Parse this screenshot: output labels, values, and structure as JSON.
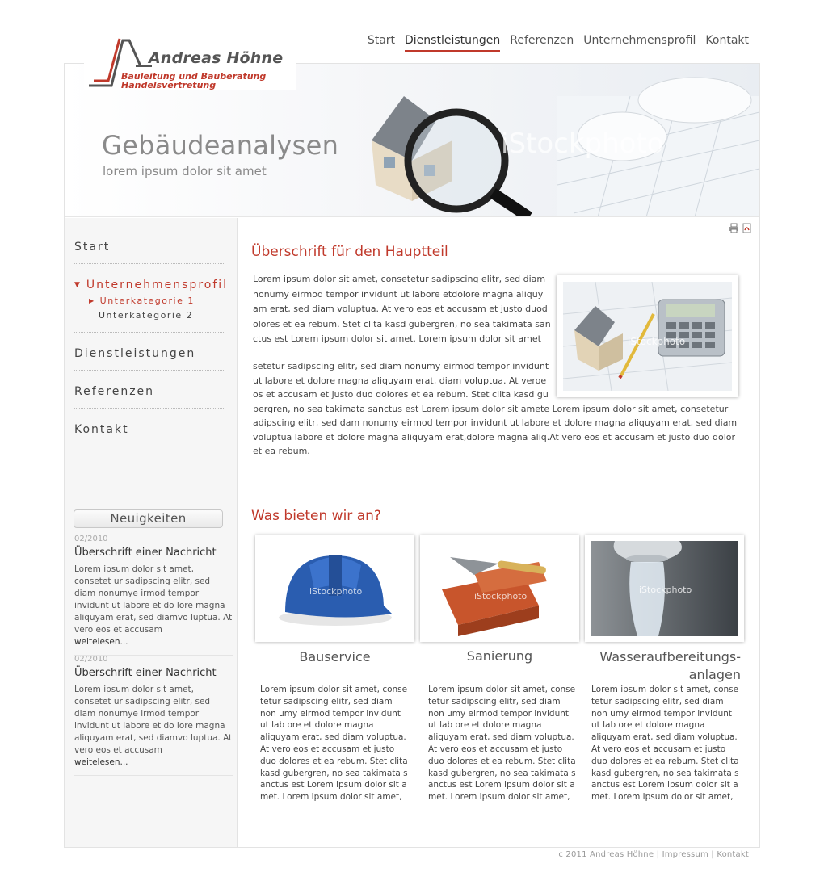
{
  "topnav": [
    {
      "label": "Start"
    },
    {
      "label": "Dienstleistungen"
    },
    {
      "label": "Referenzen"
    },
    {
      "label": "Unternehmensprofil"
    },
    {
      "label": "Kontakt"
    }
  ],
  "logo": {
    "name": "Andreas Höhne",
    "tagline1": "Bauleitung und Bauberatung",
    "tagline2": "Handelsvertretung"
  },
  "banner": {
    "title": "Gebäudeanalysen",
    "subtitle": "lorem ipsum dolor sit amet",
    "watermark": "iStockphoto"
  },
  "sidebar": {
    "start": "Start",
    "profil": "Unternehmensprofil",
    "sub1": "Unterkategorie 1",
    "sub2": "Unterkategorie 2",
    "dienst": "Dienstleistungen",
    "referenzen": "Referenzen",
    "kontakt": "Kontakt"
  },
  "news": {
    "heading": "Neuigkeiten",
    "items": [
      {
        "date": "02/2010",
        "title": "Überschrift einer Nachricht",
        "body": "Lorem ipsum dolor sit amet, consetet ur sadipscing elitr, sed diam nonumye irmod tempor invidunt ut labore et do lore magna aliquyam erat, sed diamvo luptua. At vero eos et accusam",
        "more": "weitelesen..."
      },
      {
        "date": "02/2010",
        "title": "Überschrift einer Nachricht",
        "body": "Lorem ipsum dolor sit amet, consetet ur sadipscing elitr, sed diam nonumye irmod tempor invidunt ut labore et do lore magna aliquyam erat, sed diamvo luptua. At vero eos et accusam",
        "more": "weitelesen..."
      }
    ]
  },
  "main": {
    "heading": "Überschrift für den Hauptteil",
    "p1": "Lorem ipsum dolor sit amet, consetetur sadipscing elitr, sed diam nonumy eirmod tempor invidunt ut labore etdolore magna aliquy am erat, sed diam voluptua. At vero eos et accusam et justo duod olores et ea rebum. Stet clita kasd gubergren, no sea takimata san ctus est Lorem ipsum dolor sit amet. Lorem ipsum dolor sit amet",
    "p2a": "setetur sadipscing elitr, sed diam nonumy eirmod tempor invidunt ut labore et dolore magna aliquyam erat, diam voluptua. At veroe os et accusam et justo duo dolores et ea rebum. Stet clita kasd gu",
    "p2b": "bergren, no sea takimata sanctus est Lorem ipsum dolor sit amete Lorem ipsum dolor sit amet, consetetur adipscing elitr, sed dam nonumy eirmod tempor invidunt ut labore et dolore magna aliquyam erat, sed diam voluptua labore et dolore magna aliquyam erat,dolore magna aliq.At vero eos et accusam et justo duo dolor et ea rebum.",
    "image_watermark": "iStockphoto"
  },
  "offers": {
    "heading": "Was bieten wir an?",
    "cards": [
      {
        "title": "Bauservice",
        "watermark": "iStockphoto",
        "text1": "Lorem ipsum dolor sit amet, conse tetur sadipscing elitr, sed diam non umy eirmod tempor invidunt ut lab ore et dolore magna aliquyam erat, sed diam voluptua. At vero eos et accusam et justo",
        "text2": "duo dolores et ea rebum. Stet clita kasd gubergren, no sea takimata s anctus est Lorem ipsum dolor sit a met. Lorem ipsum dolor sit amet,"
      },
      {
        "title": "Sanierung",
        "watermark": "iStockphoto",
        "text1": "Lorem ipsum dolor sit amet, conse tetur sadipscing elitr, sed diam non umy eirmod tempor invidunt ut lab ore et dolore magna aliquyam erat, sed diam voluptua. At vero eos et accusam et justo",
        "text2": "duo dolores et ea rebum. Stet clita kasd gubergren, no sea takimata s anctus est Lorem ipsum dolor sit a met. Lorem ipsum dolor sit amet,"
      },
      {
        "title": "Wasseraufbereitungs-\nanlagen",
        "watermark": "iStockphoto",
        "text1": "Lorem ipsum dolor sit amet, conse tetur sadipscing elitr, sed diam non umy eirmod tempor invidunt ut lab ore et dolore magna aliquyam erat, sed diam voluptua. At vero eos et accusam et justo",
        "text2": "duo dolores et ea rebum. Stet clita kasd gubergren, no sea takimata s anctus est Lorem ipsum dolor sit a met. Lorem ipsum dolor sit amet,"
      }
    ]
  },
  "footer": {
    "copyright": "c 2011 Andreas Höhne",
    "sep1": "|",
    "impressum": "Impressum",
    "sep2": "|",
    "kontakt": "Kontakt"
  },
  "colors": {
    "accent": "#c0392b",
    "text": "#444444",
    "muted": "#8a8a8a"
  },
  "icons": [
    "print-icon",
    "pdf-icon"
  ]
}
